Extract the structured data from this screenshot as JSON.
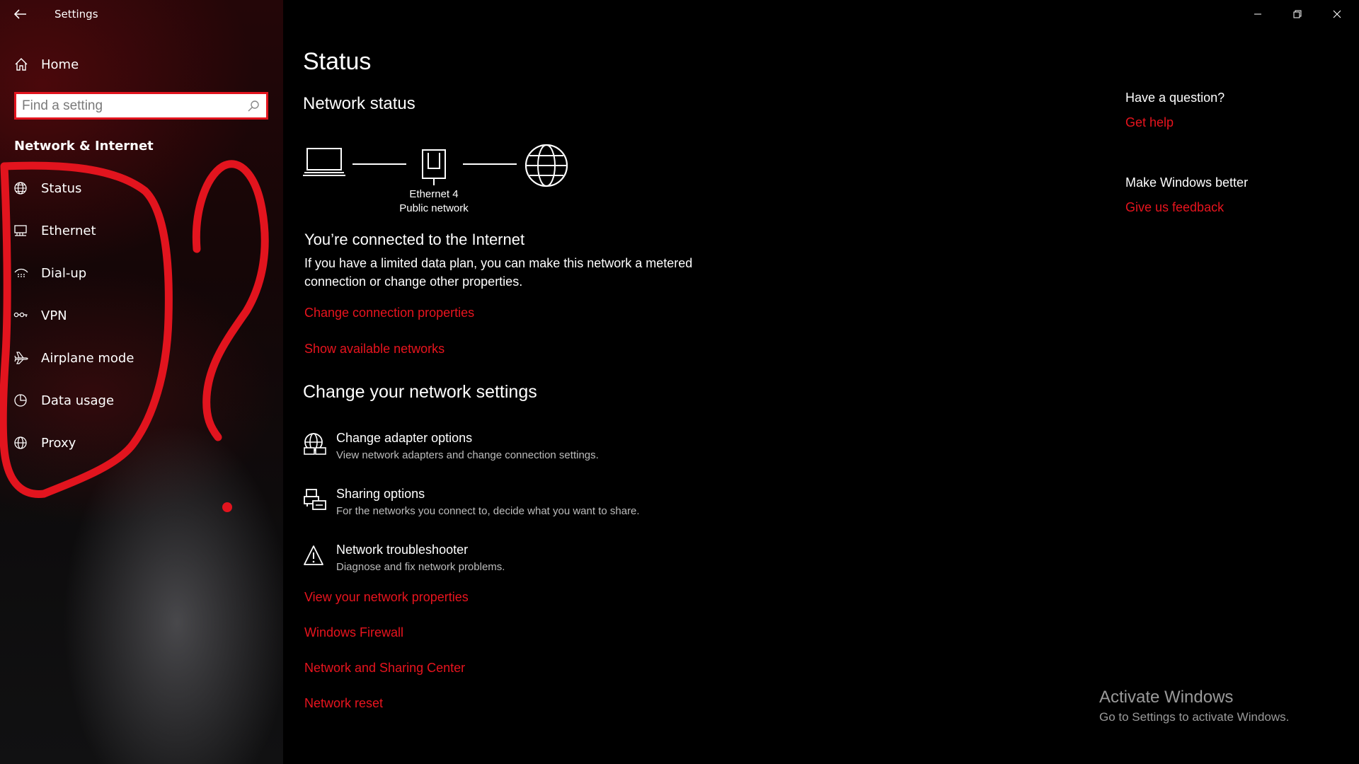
{
  "window": {
    "app_title": "Settings",
    "controls": [
      "minimize-icon",
      "restore-icon",
      "close-icon"
    ]
  },
  "sidebar": {
    "home_label": "Home",
    "search_placeholder": "Find a setting",
    "search_value": "",
    "section_heading": "Network & Internet",
    "items": [
      {
        "label": "Status",
        "icon": "status-globe-icon"
      },
      {
        "label": "Ethernet",
        "icon": "ethernet-icon"
      },
      {
        "label": "Dial-up",
        "icon": "dialup-icon"
      },
      {
        "label": "VPN",
        "icon": "vpn-icon"
      },
      {
        "label": "Airplane mode",
        "icon": "airplane-icon"
      },
      {
        "label": "Data usage",
        "icon": "data-usage-icon"
      },
      {
        "label": "Proxy",
        "icon": "globe-icon"
      }
    ]
  },
  "main": {
    "title": "Status",
    "network_status_heading": "Network status",
    "diagram": {
      "adapter_name": "Ethernet 4",
      "network_type": "Public network"
    },
    "connected_title": "You’re connected to the Internet",
    "connected_desc": "If you have a limited data plan, you can make this network a metered connection or change other properties.",
    "links_top": [
      "Change connection properties",
      "Show available networks"
    ],
    "change_heading": "Change your network settings",
    "options": [
      {
        "title": "Change adapter options",
        "desc": "View network adapters and change connection settings.",
        "icon": "adapter-icon"
      },
      {
        "title": "Sharing options",
        "desc": "For the networks you connect to, decide what you want to share.",
        "icon": "sharing-icon"
      },
      {
        "title": "Network troubleshooter",
        "desc": "Diagnose and fix network problems.",
        "icon": "warning-icon"
      }
    ],
    "links_bottom": [
      "View your network properties",
      "Windows Firewall",
      "Network and Sharing Center",
      "Network reset"
    ]
  },
  "side_panel": {
    "question_heading": "Have a question?",
    "get_help": "Get help",
    "better_heading": "Make Windows better",
    "feedback": "Give us feedback"
  },
  "watermark": {
    "line1": "Activate Windows",
    "line2": "Go to Settings to activate Windows."
  },
  "colors": {
    "accent": "#e8141e",
    "annotation": "#e2141e",
    "background": "#000000"
  }
}
